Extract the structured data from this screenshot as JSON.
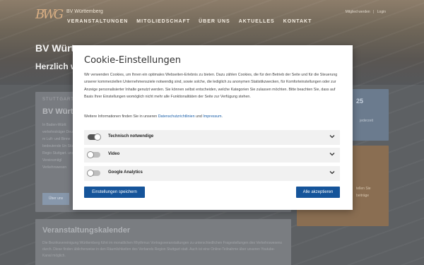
{
  "site": {
    "brand": "BV Württemberg",
    "logo_text": "BWG",
    "user_links": [
      "Mitglied werden",
      "|",
      "Login"
    ],
    "nav": [
      "VERANSTALTUNGEN",
      "MITGLIEDSCHAFT",
      "ÜBER UNS",
      "AKTUELLES",
      "KONTAKT"
    ],
    "hero_title": "BV Würt",
    "hero_subtitle": "Herzlich w",
    "left_card": {
      "kicker": "STUTTGART",
      "title": "BV Würt",
      "text": "In Baden-Württ verkehrsträger Deutschen m Luft- und Binne bedeutende Un Sitz in der Regio Stuttgart. unser Vereinsmitgl Verkehrswesen",
      "button": "Über uns"
    },
    "blue_card": {
      "big": "25",
      "small": "jederzeit"
    },
    "orange_card": {
      "l1": "",
      "l2": "tellen Sie",
      "l3": "beiträge"
    },
    "events_card": {
      "title": "Veranstaltungskalender",
      "text": "Die Bezirksvereinigung Württemberg führt im monatlichen Rhythmus Vortragsveranstaltungen zu unterschiedlichen Fragestellungen des Verkehrswesens durch. Diese finden üblicherweise in den Räumlichkeiten des Verbands Region Stuttgart statt. Auch ist eine Online-Teilnahme über unseren Youtube-Kanal möglich."
    }
  },
  "modal": {
    "title": "Cookie-Einstellungen",
    "body": "Wir verwenden Cookies, um Ihnen ein optimales Webseiten-Erlebnis zu bieten. Dazu zählen Cookies, die für den Betrieb der Seite und für die Steuerung unserer kommerziellen Unternehmensziele notwendig sind, sowie solche, die lediglich zu anonymen Statistikzwecken, für Komforteinstellungen oder zur Anzeige personalisierter Inhalte genutzt werden. Sie können selbst entscheiden, welche Kategorien Sie zulassen möchten. Bitte beachten Sie, dass auf Basis Ihrer Einstellungen womöglich nicht mehr alle Funktionalitäten der Seite zur Verfügung stehen.",
    "more_prefix": "Weitere Informationen finden Sie in unseren ",
    "privacy_link": "Datenschutzrichtlinien",
    "and": " und ",
    "imprint_link": "Impressum",
    "period": ".",
    "settings": [
      {
        "label": "Technisch notwendige",
        "enabled": true
      },
      {
        "label": "Video",
        "enabled": false
      },
      {
        "label": "Google Analytics",
        "enabled": false
      }
    ],
    "save_label": "Einstellungen speichern",
    "accept_label": "Alle akzeptieren"
  }
}
